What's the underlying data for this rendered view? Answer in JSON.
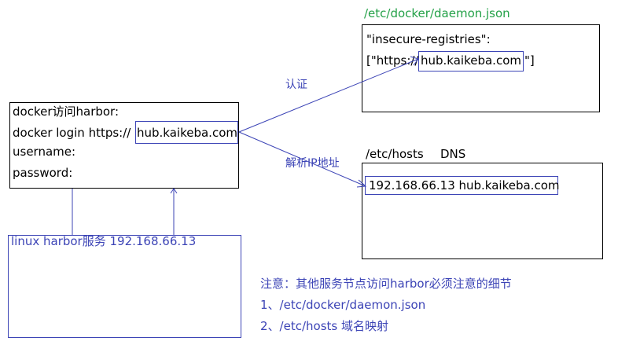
{
  "daemon_file": {
    "path": "/etc/docker/daemon.json",
    "line1": "\"insecure-registries\":",
    "line2_prefix": "[\"https://",
    "line2_host": "hub.kaikeba.com",
    "line2_suffix": "\"]"
  },
  "client": {
    "line1": "docker访问harbor:",
    "login_prefix": "docker login https://",
    "login_host": "hub.kaikeba.com",
    "line3": "username:",
    "line4": "password:"
  },
  "hosts_file": {
    "path": "/etc/hosts",
    "dns_label": "DNS",
    "entry": "192.168.66.13 hub.kaikeba.com"
  },
  "arrows": {
    "auth_label": "认证",
    "resolve_label": "解析IP地址"
  },
  "server": {
    "label": "linux  harbor服务 192.168.66.13"
  },
  "notes": {
    "title": "注意：其他服务节点访问harbor必须注意的细节",
    "item1": "1、/etc/docker/daemon.json",
    "item2": "2、/etc/hosts 域名映射"
  },
  "colors": {
    "line_blue": "#3c44b6",
    "path_green": "#24a148",
    "border_black": "#000000"
  }
}
